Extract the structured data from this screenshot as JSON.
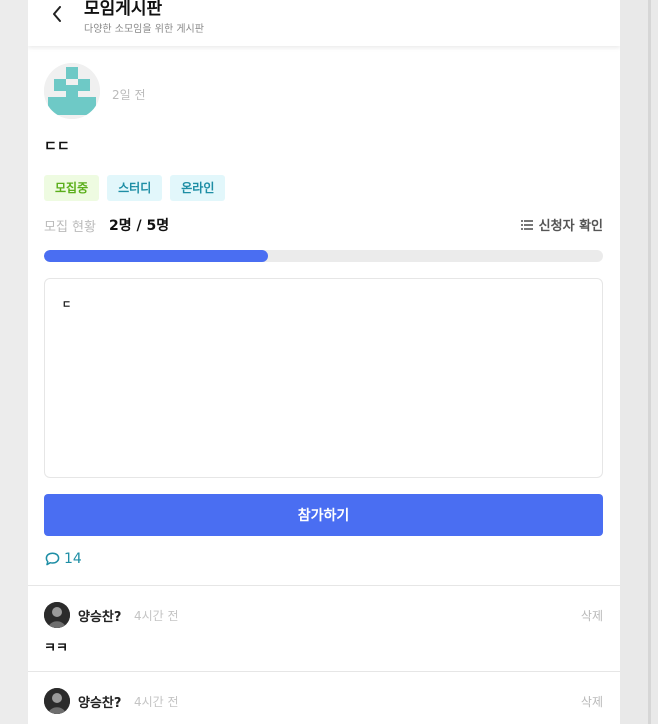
{
  "header": {
    "title": "모임게시판",
    "subtitle": "다양한 소모임을 위한 게시판",
    "back_icon": "chevron-left-icon"
  },
  "post": {
    "time": "2일 전",
    "title": "ㄷㄷ",
    "tags": [
      {
        "label": "모집중",
        "color": "#5aae1a"
      },
      {
        "label": "스터디",
        "color": "#1e8ea5"
      },
      {
        "label": "온라인",
        "color": "#1e8ea5"
      }
    ],
    "status_label": "모집 현황",
    "status_value": "2명 / 5명",
    "progress": 0.4,
    "applicants_label": "신청자 확인",
    "applicants_icon": "list-icon",
    "content": "ㄷ",
    "join_label": "참가하기",
    "comment_icon": "speech-bubble-icon",
    "comment_count": "14"
  },
  "comments": [
    {
      "author": "양승찬?",
      "time": "4시간 전",
      "delete_label": "삭제",
      "text": "ㅋㅋ"
    },
    {
      "author": "양승찬?",
      "time": "4시간 전",
      "delete_label": "삭제",
      "text": ""
    }
  ],
  "colors": {
    "accent": "#4a6ef2",
    "teal": "#1e8ea5",
    "avatar_teal": "#6ec9c6"
  }
}
